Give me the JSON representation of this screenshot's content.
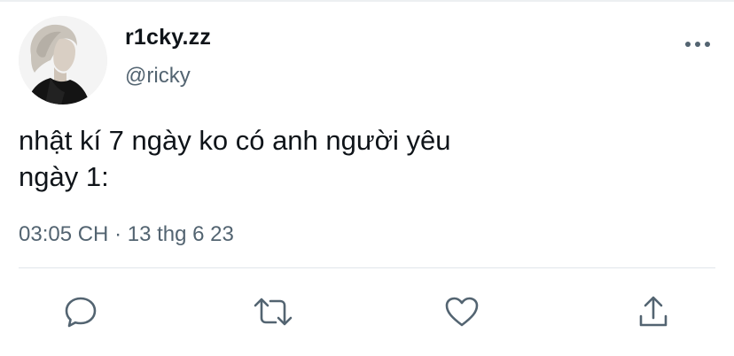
{
  "author": {
    "display_name": "r1cky.zz",
    "handle": "@ricky",
    "avatar_icon": "person-avatar"
  },
  "tweet": {
    "lines": [
      "nhật kí 7 ngày ko có anh người yêu",
      "ngày 1:"
    ],
    "time": "03:05 CH",
    "separator": "·",
    "date": "13 thg 6 23"
  },
  "actions": {
    "more": "more-horizontal-icon",
    "reply": "reply-bubble-icon",
    "retweet": "retweet-icon",
    "like": "heart-icon",
    "share": "share-upload-icon"
  },
  "colors": {
    "text_primary": "#0f1419",
    "text_secondary": "#536471",
    "divider": "#e1e6ea"
  }
}
